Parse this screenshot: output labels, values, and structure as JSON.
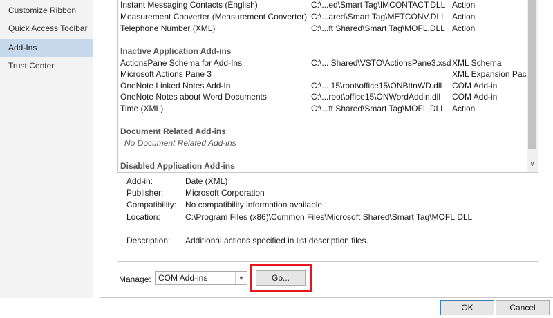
{
  "nav": {
    "items": [
      {
        "label": "Customize Ribbon",
        "selected": false
      },
      {
        "label": "Quick Access Toolbar",
        "selected": false
      },
      {
        "label": "Add-Ins",
        "selected": true
      },
      {
        "label": "Trust Center",
        "selected": false
      }
    ]
  },
  "addins": {
    "active_rows": [
      {
        "name": "Instant Messaging Contacts (English)",
        "location": "C:\\...ed\\Smart Tag\\IMCONTACT.DLL",
        "type": "Action"
      },
      {
        "name": "Measurement Converter (Measurement Converter)",
        "location": "C:\\...ared\\Smart Tag\\METCONV.DLL",
        "type": "Action"
      },
      {
        "name": "Telephone Number (XML)",
        "location": "C:\\...ft Shared\\Smart Tag\\MOFL.DLL",
        "type": "Action"
      }
    ],
    "inactive_header": "Inactive Application Add-ins",
    "inactive_rows": [
      {
        "name": "ActionsPane Schema for Add-Ins",
        "location": "C:\\... Shared\\VSTO\\ActionsPane3.xsd",
        "type": "XML Schema"
      },
      {
        "name": "Microsoft Actions Pane 3",
        "location": "",
        "type": "XML Expansion Pack"
      },
      {
        "name": "OneNote Linked Notes Add-In",
        "location": "C:\\... 15\\root\\office15\\ONBttnWD.dll",
        "type": "COM Add-in"
      },
      {
        "name": "OneNote Notes about Word Documents",
        "location": "C:\\...root\\office15\\ONWordAddin.dll",
        "type": "COM Add-in"
      },
      {
        "name": "Time (XML)",
        "location": "C:\\...ft Shared\\Smart Tag\\MOFL.DLL",
        "type": "Action"
      }
    ],
    "document_header": "Document Related Add-ins",
    "document_empty": "No Document Related Add-ins",
    "disabled_header": "Disabled Application Add-ins"
  },
  "details": {
    "addin_label": "Add-in:",
    "addin_value": "Date (XML)",
    "publisher_label": "Publisher:",
    "publisher_value": "Microsoft Corporation",
    "compat_label": "Compatibility:",
    "compat_value": "No compatibility information available",
    "location_label": "Location:",
    "location_value": "C:\\Program Files (x86)\\Common Files\\Microsoft Shared\\Smart Tag\\MOFL.DLL",
    "description_label": "Description:",
    "description_value": "Additional actions specified in list description files."
  },
  "manage": {
    "label": "Manage:",
    "selected": "COM Add-ins",
    "go_label": "Go..."
  },
  "footer": {
    "ok_label": "OK",
    "cancel_label": "Cancel"
  },
  "colors": {
    "nav_selected": "#c5d8ec",
    "highlight": "#e4161e"
  }
}
